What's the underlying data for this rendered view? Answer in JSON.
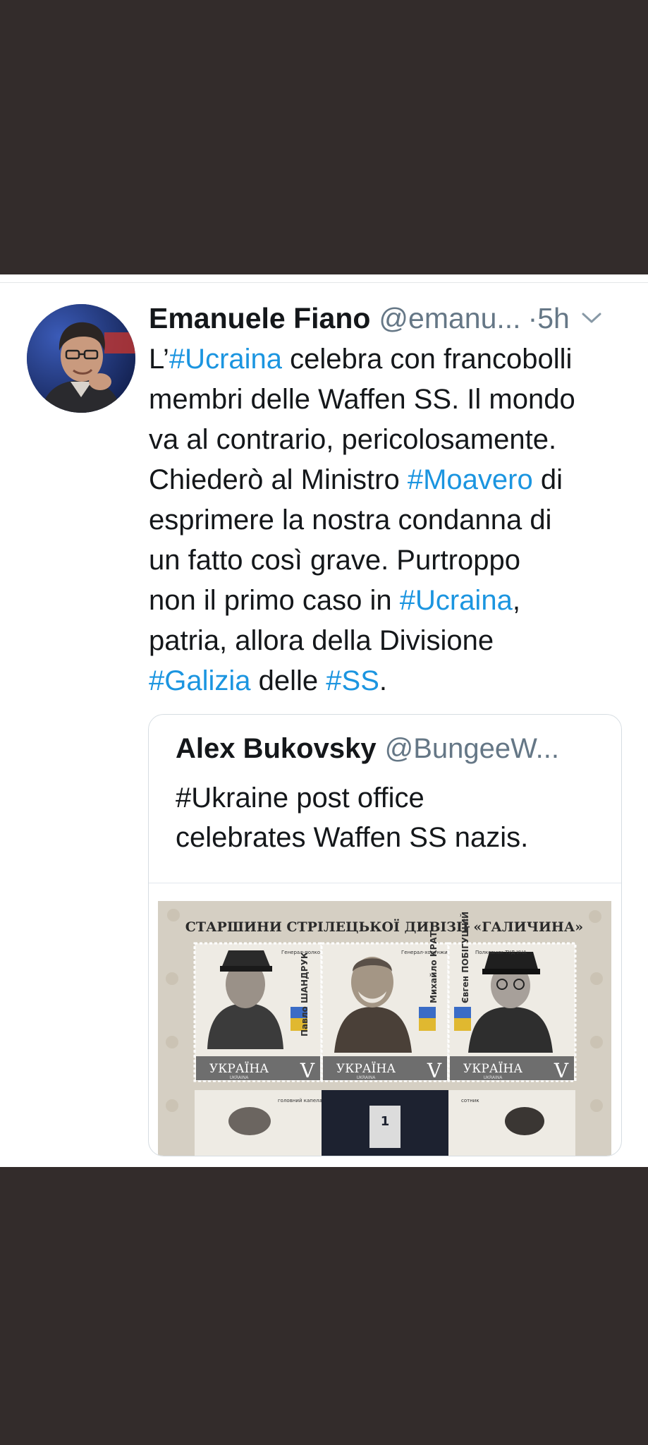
{
  "tweet": {
    "author_name": "Emanuele Fiano",
    "author_handle": "@emanu...",
    "time": "·5h",
    "avatar_icon": "person-avatar",
    "more_icon": "chevron-down-icon",
    "text_lines": [
      [
        {
          "t": "L’"
        },
        {
          "t": "#Ucraina",
          "tag": true
        },
        {
          "t": " celebra con francobolli"
        }
      ],
      [
        {
          "t": "membri delle Waffen SS. Il mondo"
        }
      ],
      [
        {
          "t": "va al contrario, pericolosamente."
        }
      ],
      [
        {
          "t": "Chiederò al Ministro "
        },
        {
          "t": "#Moavero",
          "tag": true
        },
        {
          "t": " di"
        }
      ],
      [
        {
          "t": "esprimere la nostra condanna di"
        }
      ],
      [
        {
          "t": "un fatto così grave. Purtroppo"
        }
      ],
      [
        {
          "t": "non il primo caso in "
        },
        {
          "t": "#Ucraina",
          "tag": true
        },
        {
          "t": ","
        }
      ],
      [
        {
          "t": "patria, allora della Divisione"
        }
      ],
      [
        {
          "t": "#Galizia",
          "tag": true
        },
        {
          "t": " delle "
        },
        {
          "t": "#SS",
          "tag": true
        },
        {
          "t": "."
        }
      ]
    ],
    "hashtag_color": "#1b95e0"
  },
  "quoted": {
    "author_name": "Alex Bukovsky",
    "author_handle": "@BungeeW...",
    "text_lines": [
      "#Ukraine post office",
      "celebrates Waffen SS nazis."
    ],
    "image": {
      "title": "СТАРШИНИ СТРІЛЕЦЬКОЇ ДИВІЗІЇ «ГАЛИЧИНА»",
      "stamps": [
        {
          "rank": "Генерал-полковник ТУД УНА",
          "name": "Павло ШАНДРУК",
          "country": "УКРАЇНА",
          "sub": "UKRAINA",
          "value": "V"
        },
        {
          "rank": "Генерал-хорунжий ТУД УНА",
          "name": "Михайло КРАТ",
          "country": "УКРАЇНА",
          "sub": "UKRAINA",
          "value": "V"
        },
        {
          "rank": "Полковник ТУД УНА",
          "name": "Євген ПОБІГУЩИЙ",
          "country": "УКРАЇНА",
          "sub": "UKRAINA",
          "value": "V"
        }
      ],
      "bottom_row": [
        "головний капелан",
        "1",
        "сотник"
      ]
    }
  },
  "colors": {
    "background": "#332c2b",
    "card": "#ffffff",
    "name": "#14171a",
    "secondary": "#657786"
  }
}
